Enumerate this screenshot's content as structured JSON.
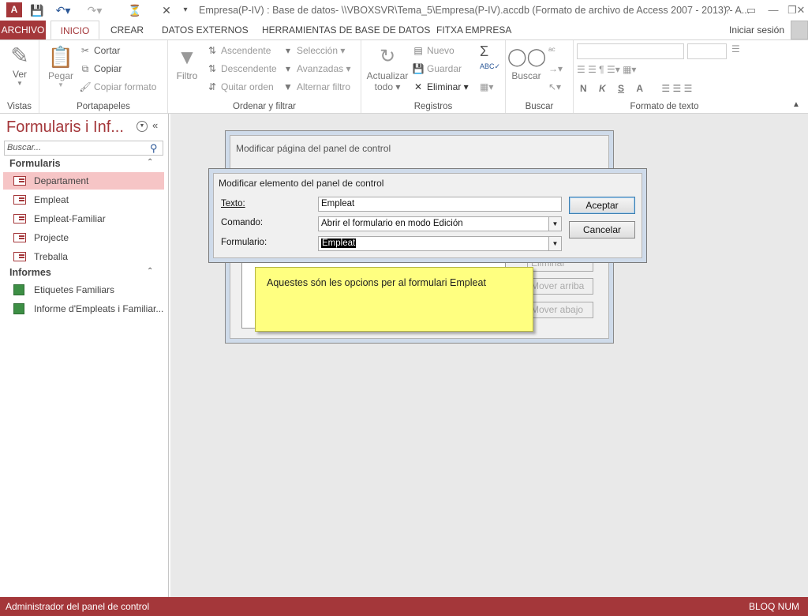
{
  "window": {
    "title": "Empresa(P-IV) : Base de datos- \\\\VBOXSVR\\Tema_5\\Empresa(P-IV).accdb (Formato de archivo de Access 2007 - 2013) - A...",
    "help": "?",
    "restore_ribbon": "▭",
    "minimize": "—",
    "maximize": "❐",
    "close": "✕"
  },
  "quick_access": {
    "app_icon": "access-logo",
    "save": "save-icon",
    "undo": "undo-icon",
    "redo": "redo-icon"
  },
  "tabs": [
    "ARCHIVO",
    "INICIO",
    "CREAR",
    "DATOS EXTERNOS",
    "HERRAMIENTAS DE BASE DE DATOS",
    "FITXA EMPRESA"
  ],
  "signin": "Iniciar sesión",
  "ribbon": {
    "vistas": {
      "label": "Vistas",
      "ver": "Ver"
    },
    "portapapeles": {
      "label": "Portapapeles",
      "pegar": "Pegar",
      "cortar": "Cortar",
      "copiar": "Copiar",
      "copiar_formato": "Copiar formato"
    },
    "ordenar": {
      "label": "Ordenar y filtrar",
      "filtro": "Filtro",
      "ascendente": "Ascendente",
      "descendente": "Descendente",
      "quitar_orden": "Quitar orden",
      "seleccion": "Selección",
      "avanzadas": "Avanzadas",
      "alternar_filtro": "Alternar filtro"
    },
    "registros": {
      "label": "Registros",
      "actualizar": "Actualizar",
      "todo": "todo",
      "nuevo": "Nuevo",
      "guardar": "Guardar",
      "eliminar": "Eliminar"
    },
    "buscar": {
      "label": "Buscar",
      "buscar": "Buscar"
    },
    "formato": {
      "label": "Formato de texto",
      "bold": "N",
      "italic": "K",
      "underline": "S",
      "fontcolor": "A"
    }
  },
  "nav": {
    "title": "Formularis i Inf...",
    "search_placeholder": "Buscar...",
    "sections": [
      {
        "name": "Formularis",
        "items": [
          "Departament",
          "Empleat",
          "Empleat-Familiar",
          "Projecte",
          "Treballa"
        ]
      },
      {
        "name": "Informes",
        "items": [
          "Etiquetes Familiars",
          "Informe d'Empleats i Familiar..."
        ]
      }
    ],
    "selected": "Departament"
  },
  "dialog_page": {
    "title": "Modificar página del panel de control",
    "buttons": [
      "Eliminar",
      "Mover arriba",
      "Mover abajo"
    ]
  },
  "dialog_item": {
    "title": "Modificar elemento del panel de control",
    "texto_label": "Texto:",
    "texto_value": "Empleat",
    "comando_label": "Comando:",
    "comando_value": "Abrir el formulario en modo Edición",
    "formulario_label": "Formulario:",
    "formulario_value": "Empleat",
    "aceptar": "Aceptar",
    "cancelar": "Cancelar"
  },
  "note": "Aquestes són les opcions per al formulari Empleat",
  "status": {
    "left": "Administrador del panel de control",
    "right": "BLOQ NUM"
  }
}
